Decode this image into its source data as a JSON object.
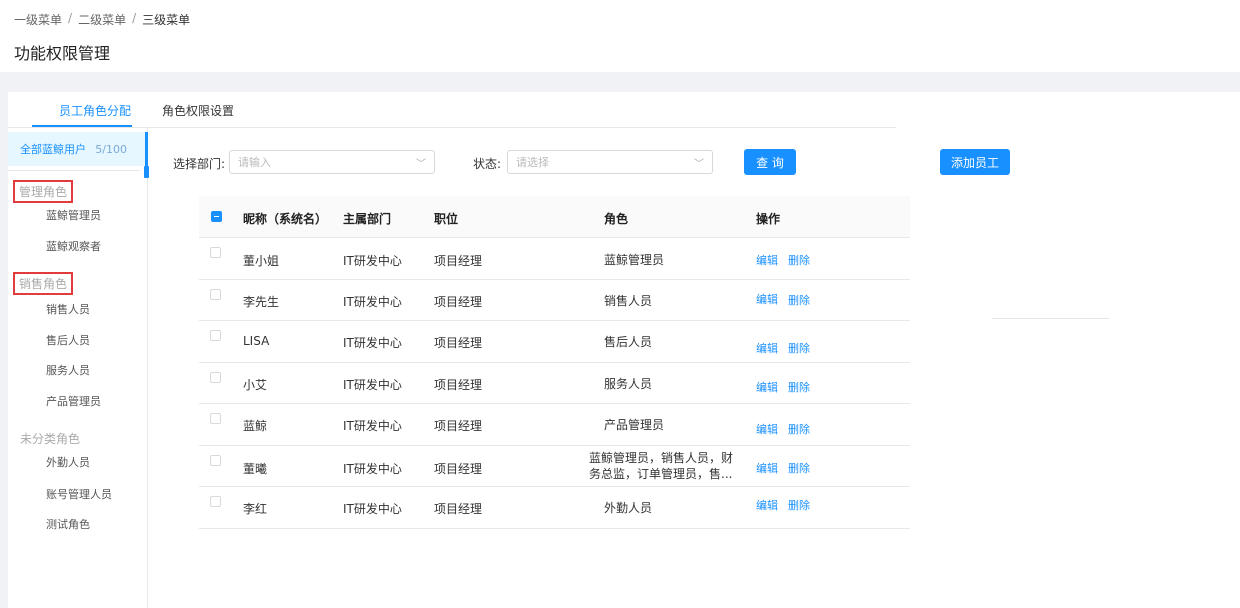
{
  "breadcrumb": {
    "level1": "一级菜单",
    "level2": "二级菜单",
    "level3": "三级菜单",
    "sep": "/"
  },
  "page_title": "功能权限管理",
  "tabs": [
    {
      "label": "员工角色分配"
    },
    {
      "label": "角色权限设置"
    }
  ],
  "sidebar": {
    "all_users": {
      "label": "全部蓝鲸用户",
      "count": "5/100"
    },
    "groups": [
      {
        "title": "管理角色",
        "items": [
          "蓝鲸管理员",
          "蓝鲸观察者"
        ]
      },
      {
        "title": "销售角色",
        "items": [
          "销售人员",
          "售后人员",
          "服务人员",
          "产品管理员"
        ]
      },
      {
        "title": "未分类角色",
        "items": [
          "外勤人员",
          "账号管理人员",
          "测试角色"
        ]
      }
    ]
  },
  "filters": {
    "dept_label": "选择部门:",
    "dept_placeholder": "请输入",
    "status_label": "状态:",
    "status_placeholder": "请选择",
    "query_button": "查 询",
    "add_button": "添加员工"
  },
  "table": {
    "columns": [
      "昵称（系统名）",
      "主属部门",
      "职位",
      "角色",
      "操作"
    ],
    "edit_label": "编辑",
    "delete_label": "删除",
    "rows": [
      {
        "name": "董小姐",
        "dept": "IT研发中心",
        "position": "项目经理",
        "role": "蓝鲸管理员"
      },
      {
        "name": "李先生",
        "dept": "IT研发中心",
        "position": "项目经理",
        "role": "销售人员"
      },
      {
        "name": "LISA",
        "dept": "IT研发中心",
        "position": "项目经理",
        "role": "售后人员"
      },
      {
        "name": "小艾",
        "dept": "IT研发中心",
        "position": "项目经理",
        "role": "服务人员"
      },
      {
        "name": "蓝鲸",
        "dept": "IT研发中心",
        "position": "项目经理",
        "role": "产品管理员"
      },
      {
        "name": "董曦",
        "dept": "IT研发中心",
        "position": "项目经理",
        "role": "蓝鲸管理员，销售人员，财务总监，订单管理员，售..."
      },
      {
        "name": "李红",
        "dept": "IT研发中心",
        "position": "项目经理",
        "role": "外勤人员"
      }
    ]
  },
  "colors": {
    "primary": "#1890ff",
    "highlight_box": "#e23b3b",
    "band": "#f0f2f5"
  }
}
